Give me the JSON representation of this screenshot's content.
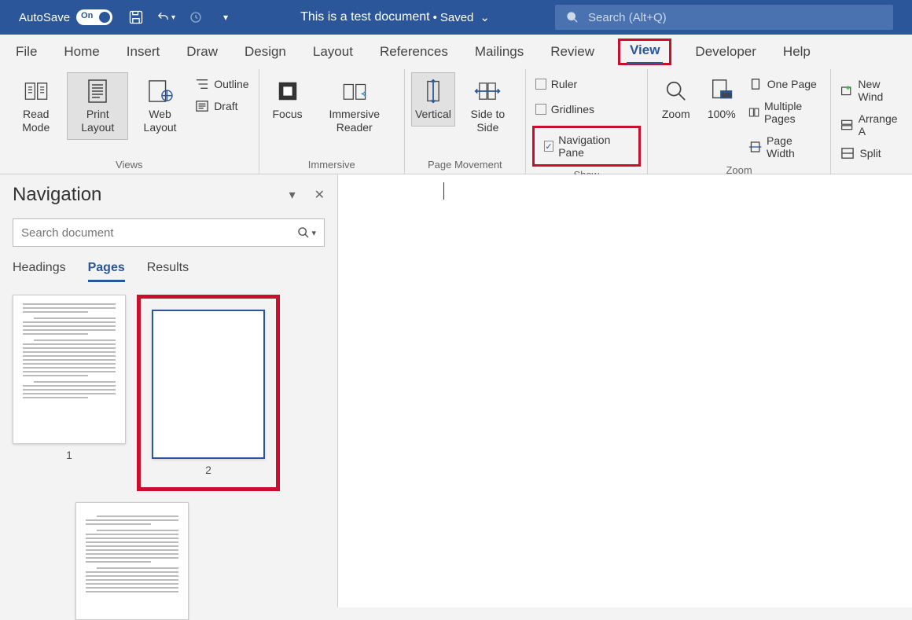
{
  "title_bar": {
    "autosave_label": "AutoSave",
    "autosave_toggle_text": "On",
    "doc_title": "This is a test document",
    "saved_state": "Saved",
    "search_placeholder": "Search (Alt+Q)"
  },
  "menu": {
    "items": [
      "File",
      "Home",
      "Insert",
      "Draw",
      "Design",
      "Layout",
      "References",
      "Mailings",
      "Review",
      "View",
      "Developer",
      "Help"
    ],
    "active": "View"
  },
  "ribbon": {
    "views": {
      "label": "Views",
      "read_mode": "Read Mode",
      "print_layout": "Print Layout",
      "web_layout": "Web Layout",
      "outline": "Outline",
      "draft": "Draft"
    },
    "immersive": {
      "label": "Immersive",
      "focus": "Focus",
      "immersive_reader": "Immersive Reader"
    },
    "page_movement": {
      "label": "Page Movement",
      "vertical": "Vertical",
      "side_to_side": "Side to Side"
    },
    "show": {
      "label": "Show",
      "ruler": "Ruler",
      "gridlines": "Gridlines",
      "navigation_pane": "Navigation Pane"
    },
    "zoom": {
      "label": "Zoom",
      "zoom_btn": "Zoom",
      "hundred": "100%",
      "one_page": "One Page",
      "multiple_pages": "Multiple Pages",
      "page_width": "Page Width"
    },
    "window": {
      "new_window": "New Wind",
      "arrange_all": "Arrange A",
      "split": "Split"
    }
  },
  "navigation": {
    "title": "Navigation",
    "search_placeholder": "Search document",
    "tabs": {
      "headings": "Headings",
      "pages": "Pages",
      "results": "Results"
    },
    "active_tab": "Pages",
    "page_numbers": [
      "1",
      "2"
    ],
    "selected_page": "2"
  }
}
